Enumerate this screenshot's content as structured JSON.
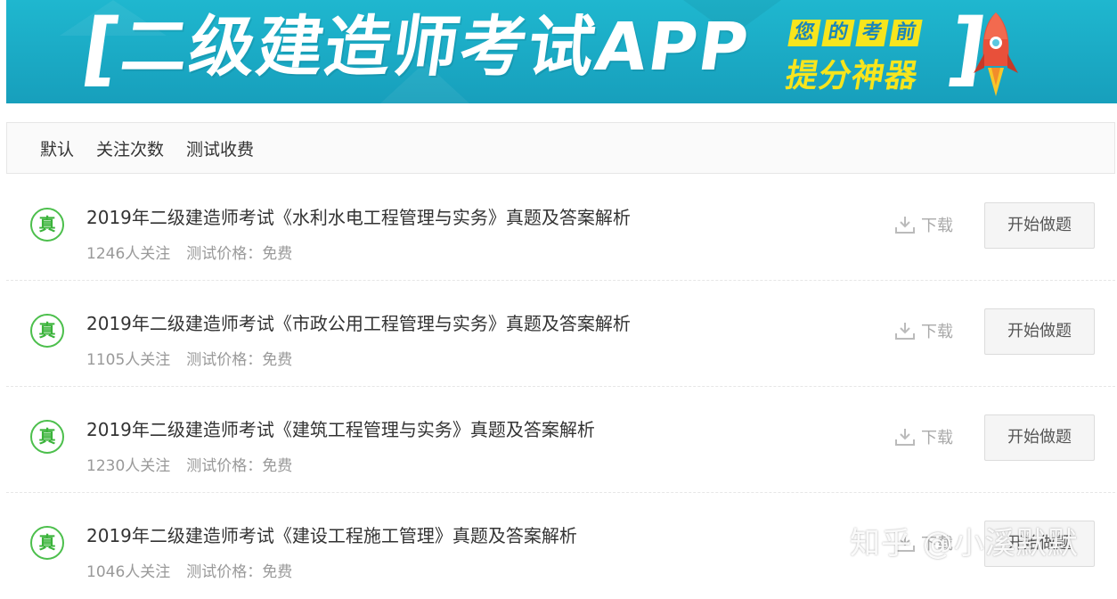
{
  "banner": {
    "bracket_left": "[",
    "title": "二级建造师考试APP",
    "tags": [
      "您",
      "的",
      "考",
      "前"
    ],
    "slogan": "提分神器",
    "bracket_right": "]",
    "bg_color": "#1aaac6",
    "accent_color": "#f7e51d"
  },
  "filters": [
    "默认",
    "关注次数",
    "测试收费"
  ],
  "exams": [
    {
      "badge": "真",
      "title": "2019年二级建造师考试《水利水电工程管理与实务》真题及答案解析",
      "followers": "1246人关注",
      "price": "测试价格：免费",
      "download_label": "下载",
      "start_label": "开始做题"
    },
    {
      "badge": "真",
      "title": "2019年二级建造师考试《市政公用工程管理与实务》真题及答案解析",
      "followers": "1105人关注",
      "price": "测试价格：免费",
      "download_label": "下载",
      "start_label": "开始做题"
    },
    {
      "badge": "真",
      "title": "2019年二级建造师考试《建筑工程管理与实务》真题及答案解析",
      "followers": "1230人关注",
      "price": "测试价格：免费",
      "download_label": "下载",
      "start_label": "开始做题"
    },
    {
      "badge": "真",
      "title": "2019年二级建造师考试《建设工程施工管理》真题及答案解析",
      "followers": "1046人关注",
      "price": "测试价格：免费",
      "download_label": "下载",
      "start_label": "开始做题"
    }
  ],
  "watermark": "知乎 @小溪默默",
  "icons": {
    "badge": "zhen-badge-icon",
    "download": "download-icon",
    "rocket": "rocket-icon"
  }
}
